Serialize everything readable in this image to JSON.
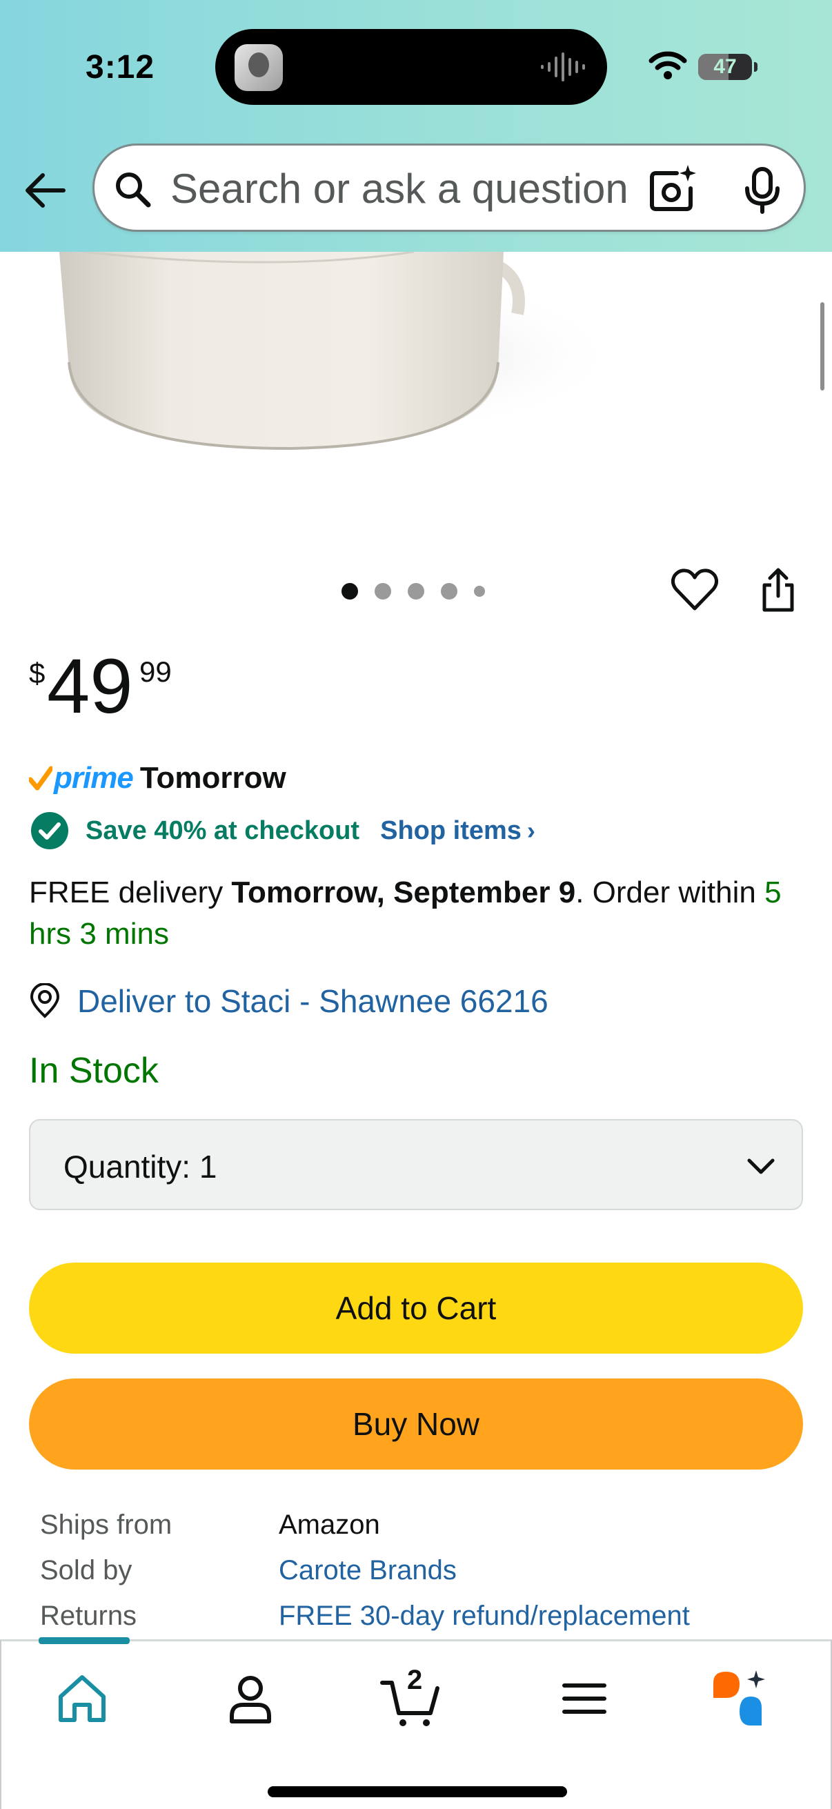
{
  "status_bar": {
    "time": "3:12",
    "battery": "47"
  },
  "header": {
    "search_placeholder": "Search or ask a question",
    "icons": [
      "back-arrow-icon",
      "search-icon",
      "camera-lens-icon",
      "microphone-icon"
    ]
  },
  "product": {
    "image_page_total": 5,
    "image_page_current": 1,
    "price": {
      "symbol": "$",
      "whole": "49",
      "fraction": "99"
    },
    "prime_label": "prime",
    "prime_delivery": "Tomorrow",
    "save_text": "Save 40% at checkout",
    "shop_items": "Shop items",
    "shop_chevron": "›",
    "delivery": {
      "prefix": "FREE delivery ",
      "date": "Tomorrow, September 9",
      "middle": ". Order within ",
      "countdown": "5 hrs 3 mins"
    },
    "deliver_to": "Deliver to Staci - Shawnee 66216",
    "stock": "In Stock",
    "quantity_label": "Quantity:  1",
    "add_to_cart": "Add to Cart",
    "buy_now": "Buy Now",
    "info": [
      {
        "key": "Ships from",
        "value": "Amazon"
      },
      {
        "key": "Sold by",
        "value": "Carote Brands"
      },
      {
        "key": "Returns",
        "value": "FREE 30-day refund/replacement"
      }
    ]
  },
  "bottom_nav": {
    "cart_count": "2",
    "items": [
      "home-icon",
      "profile-icon",
      "cart-icon",
      "menu-icon",
      "rufus-ai-icon"
    ]
  },
  "colors": {
    "header_gradient": [
      "#86d6de",
      "#a7e6d6"
    ],
    "add_to_cart": "#ffd814",
    "buy_now": "#ffa41c",
    "link": "#2162a1",
    "in_stock": "#007600",
    "save_green": "#067d62"
  }
}
